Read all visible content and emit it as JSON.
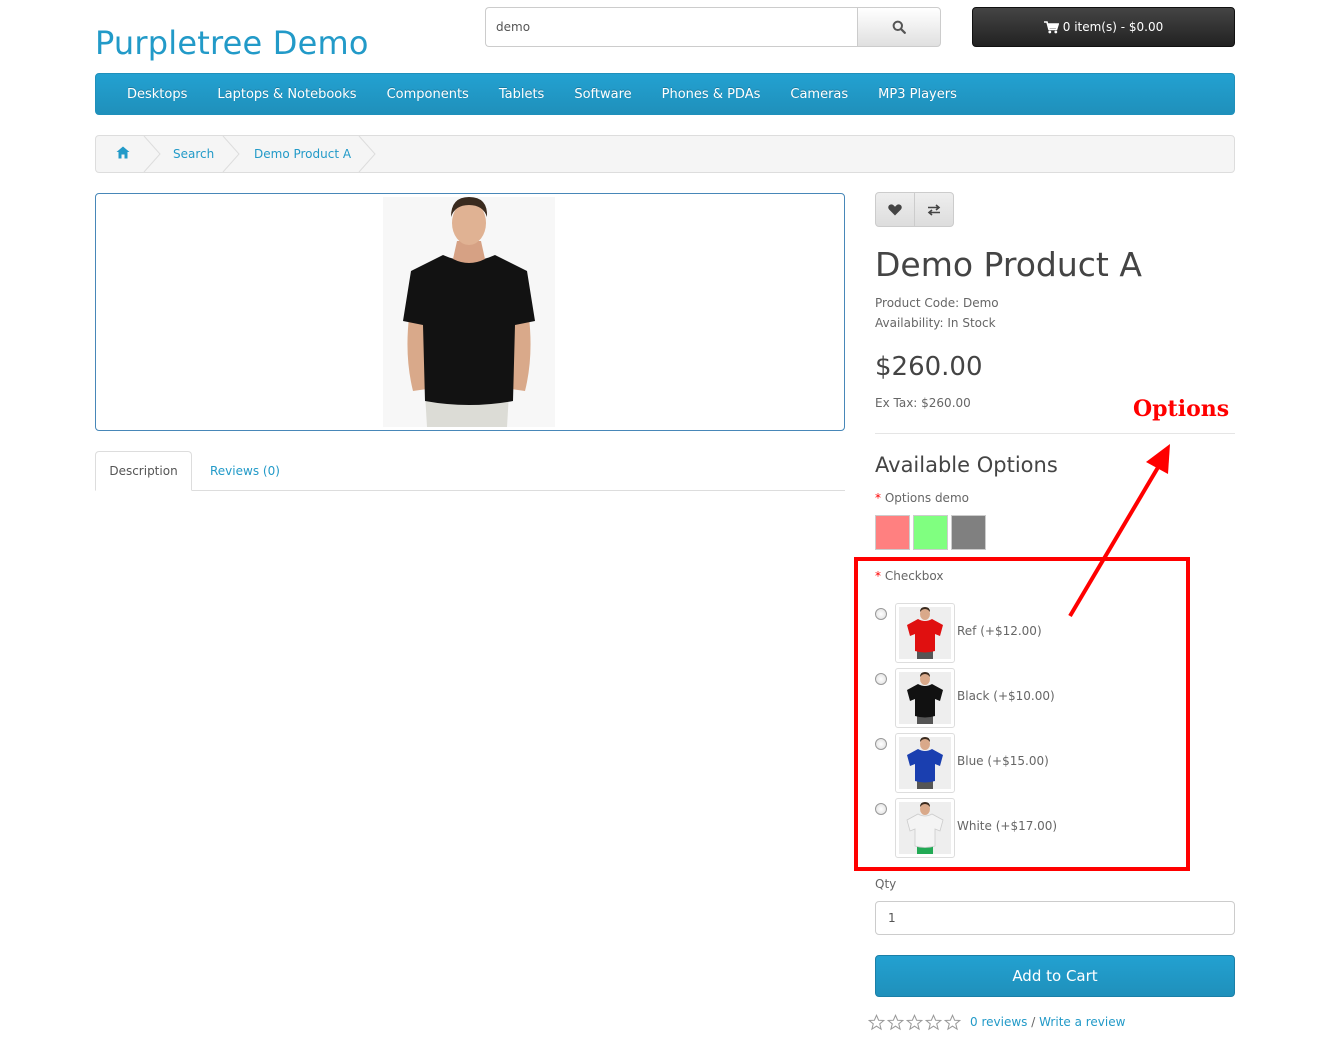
{
  "header": {
    "logo": "Purpletree Demo",
    "search_value": "demo",
    "cart_label": "0 item(s) - $0.00"
  },
  "menu": [
    "Desktops",
    "Laptops & Notebooks",
    "Components",
    "Tablets",
    "Software",
    "Phones & PDAs",
    "Cameras",
    "MP3 Players"
  ],
  "breadcrumb": [
    "Search",
    "Demo Product A"
  ],
  "tabs": {
    "description": "Description",
    "reviews": "Reviews (0)"
  },
  "product": {
    "title": "Demo Product A",
    "code": "Product Code: Demo",
    "availability": "Availability: In Stock",
    "price": "$260.00",
    "ex_tax": "Ex Tax: $260.00"
  },
  "options": {
    "heading": "Available Options",
    "color_group_label": "Options demo",
    "colors": [
      "#ff8080",
      "#80ff80",
      "#808080"
    ],
    "checkbox_group_label": "Checkbox",
    "items": [
      {
        "label": "Ref (+$12.00)",
        "shirt_color": "#e01010"
      },
      {
        "label": "Black (+$10.00)",
        "shirt_color": "#111111"
      },
      {
        "label": "Blue (+$15.00)",
        "shirt_color": "#1a3fb0"
      },
      {
        "label": "White (+$17.00)",
        "shirt_color": "#f4f4f4"
      }
    ]
  },
  "qty": {
    "label": "Qty",
    "value": "1"
  },
  "add_to_cart": "Add to Cart",
  "reviews": {
    "stars": 0,
    "count_link": "0 reviews",
    "separator": "/",
    "write_link": "Write a review"
  },
  "annotation": {
    "callout": "Options",
    "color": "#ff0000"
  }
}
